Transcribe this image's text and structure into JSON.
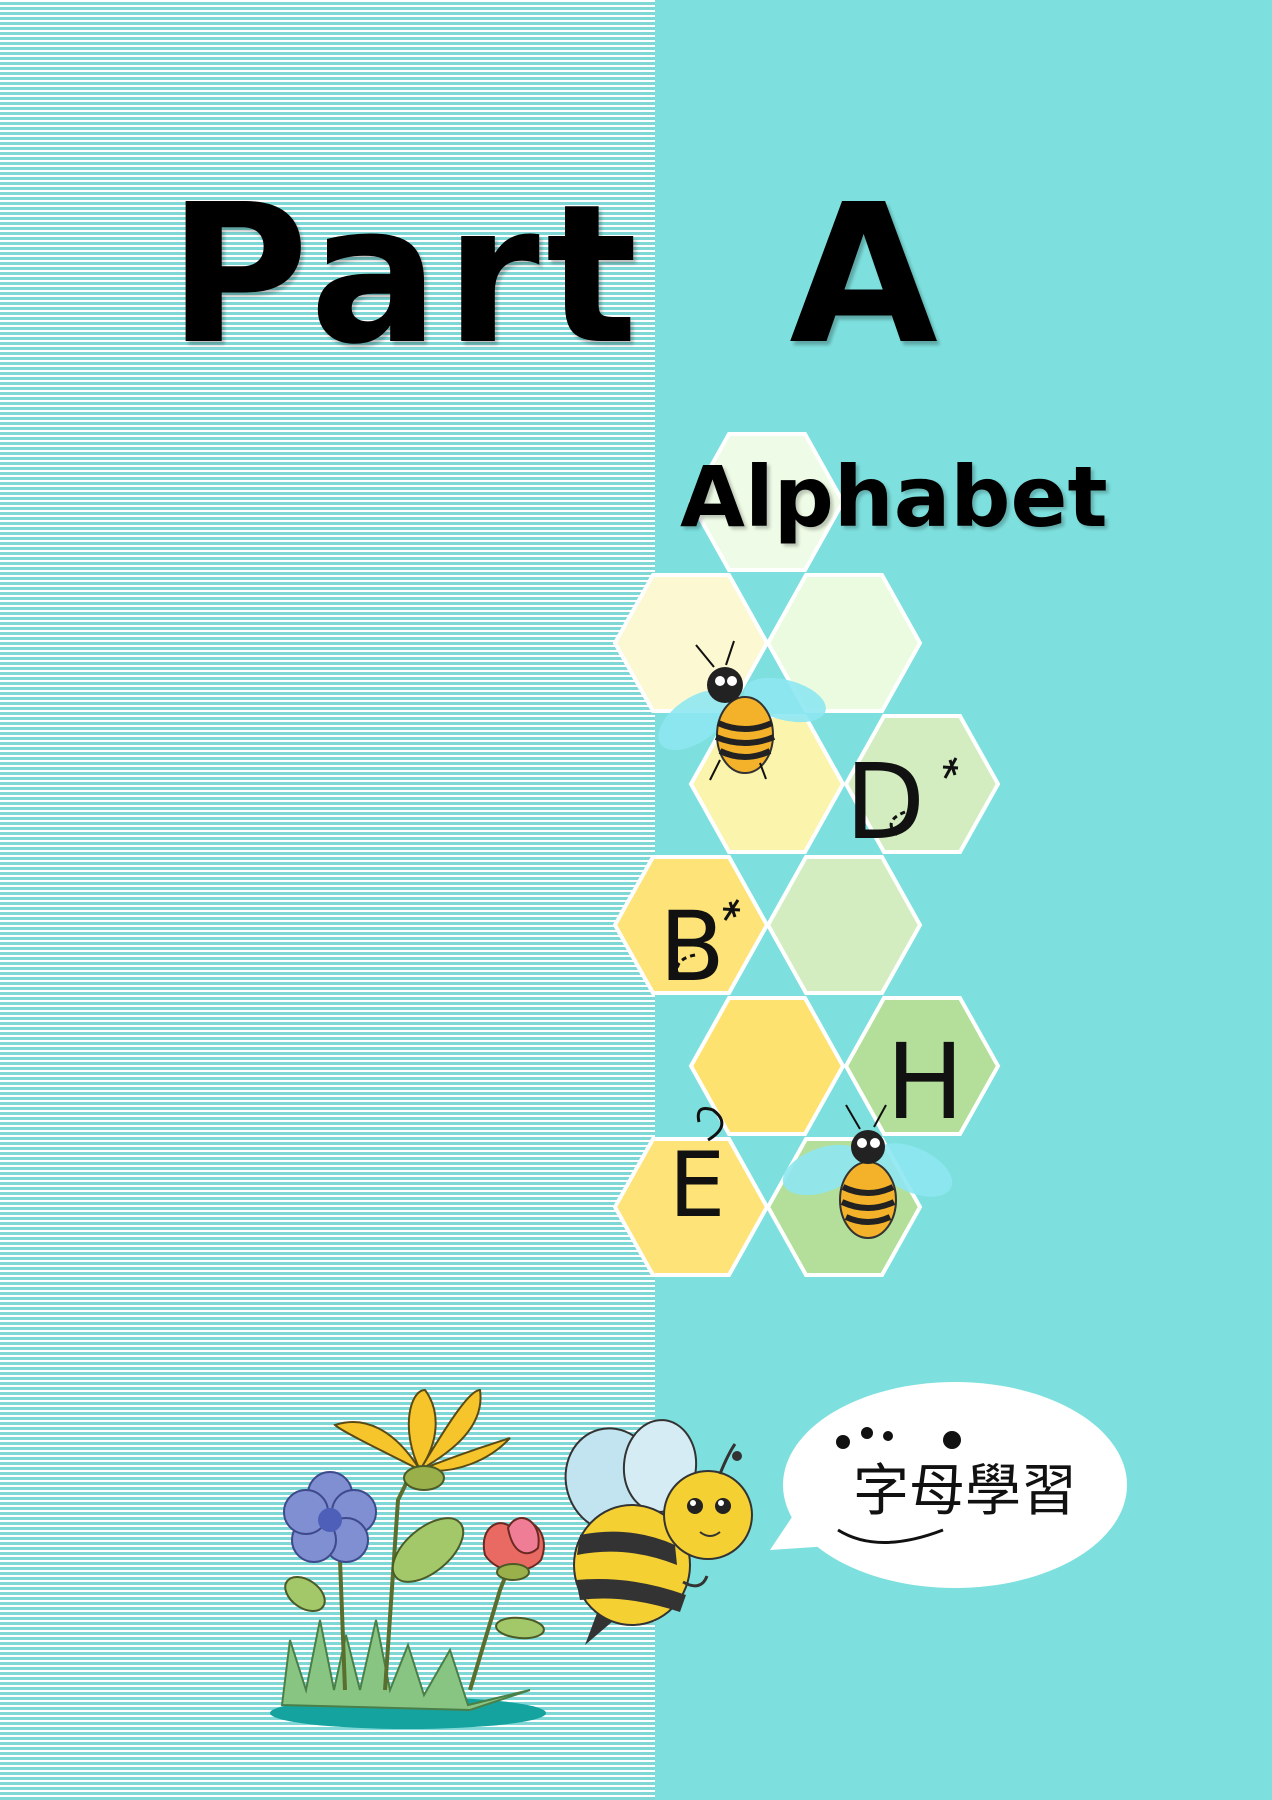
{
  "cover": {
    "title": "Part  A",
    "subtitle": "Alphabet",
    "bubble_text": "字母學習"
  },
  "honeycomb": {
    "letters": [
      "D",
      "B",
      "H",
      "E"
    ]
  },
  "colors": {
    "background": "#7de0de",
    "stripe": "#ffffff",
    "honey_yellow": "#fde378",
    "honey_light": "#fbf4ad",
    "leaf_green": "#b3df9a",
    "pale_green": "#eefbe6"
  }
}
